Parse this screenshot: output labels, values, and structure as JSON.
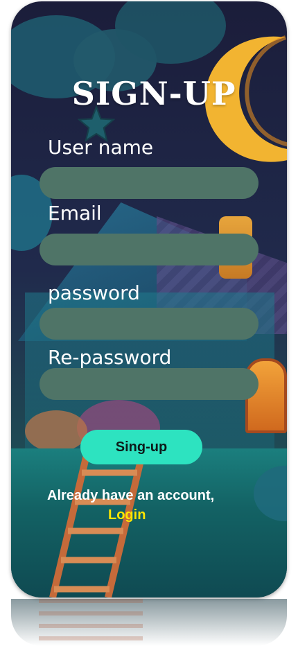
{
  "title": "SIGN-UP",
  "fields": [
    {
      "label": "User name",
      "value": "",
      "placeholder": ""
    },
    {
      "label": "Email",
      "value": "",
      "placeholder": ""
    },
    {
      "label": "password",
      "value": "",
      "placeholder": ""
    },
    {
      "label": "Re-password",
      "value": "",
      "placeholder": ""
    }
  ],
  "submit_label": "Sing-up",
  "footer": {
    "question": "Already have an account,",
    "login_link": "Login"
  },
  "colors": {
    "field_fill": "#4f7467",
    "button_fill": "#2de3c0",
    "link_color": "#ffe600",
    "moon": "#f2b431"
  },
  "background": {
    "scene": "night-house-illustration",
    "icons": [
      "moon-icon",
      "star-icon",
      "cloud-icon",
      "ladder-icon",
      "house-icon"
    ]
  }
}
